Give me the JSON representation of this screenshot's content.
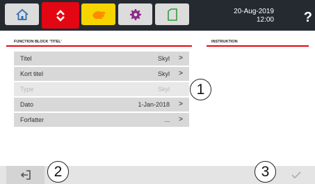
{
  "header": {
    "tabs": [
      {
        "name": "home",
        "icon": "home-icon"
      },
      {
        "name": "active-tab",
        "icon": "swap-arrows-icon",
        "color": "#e30613"
      },
      {
        "name": "hand",
        "icon": "hand-icon",
        "color": "#f5d400"
      },
      {
        "name": "settings",
        "icon": "gear-icon"
      },
      {
        "name": "document",
        "icon": "document-icon"
      }
    ],
    "date": "20-Aug-2019",
    "time": "12:00",
    "help": "?"
  },
  "left_panel": {
    "title": "FUNCTION BLOCK 'TITEL'",
    "rows": [
      {
        "label": "Titel",
        "value": "Skyl",
        "enabled": true
      },
      {
        "label": "Kort titel",
        "value": "Skyl",
        "enabled": true
      },
      {
        "label": "Type",
        "value": "Skyl",
        "enabled": false
      },
      {
        "label": "Dato",
        "value": "1-Jan-2018",
        "enabled": true
      },
      {
        "label": "Forfatter",
        "value": "...",
        "enabled": true
      }
    ]
  },
  "right_panel": {
    "title": "INSTRUKTION"
  },
  "callouts": [
    "1",
    "2",
    "3"
  ],
  "footer": {
    "back_icon": "exit-icon",
    "confirm_icon": "check-icon"
  },
  "colors": {
    "accent": "#e30613",
    "header_bg": "#252a30",
    "yellow": "#f5d400"
  }
}
